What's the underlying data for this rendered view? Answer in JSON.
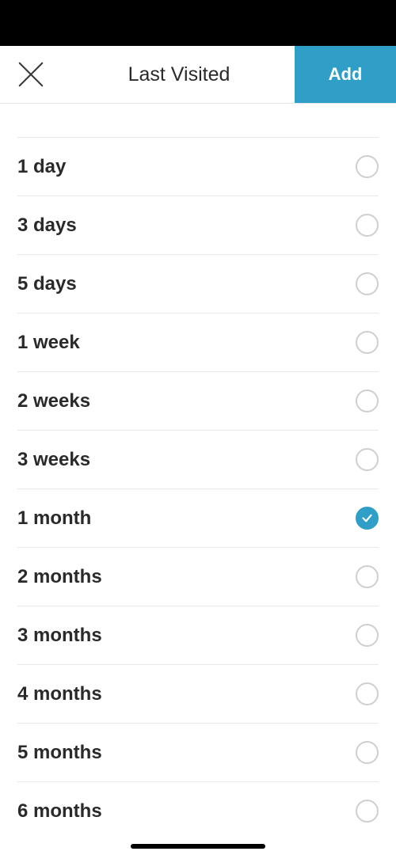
{
  "header": {
    "title": "Last Visited",
    "add_label": "Add"
  },
  "options": [
    {
      "label": "1 day",
      "selected": false
    },
    {
      "label": "3 days",
      "selected": false
    },
    {
      "label": "5 days",
      "selected": false
    },
    {
      "label": "1 week",
      "selected": false
    },
    {
      "label": "2 weeks",
      "selected": false
    },
    {
      "label": "3 weeks",
      "selected": false
    },
    {
      "label": "1 month",
      "selected": true
    },
    {
      "label": "2 months",
      "selected": false
    },
    {
      "label": "3 months",
      "selected": false
    },
    {
      "label": "4 months",
      "selected": false
    },
    {
      "label": "5 months",
      "selected": false
    },
    {
      "label": "6 months",
      "selected": false
    }
  ]
}
